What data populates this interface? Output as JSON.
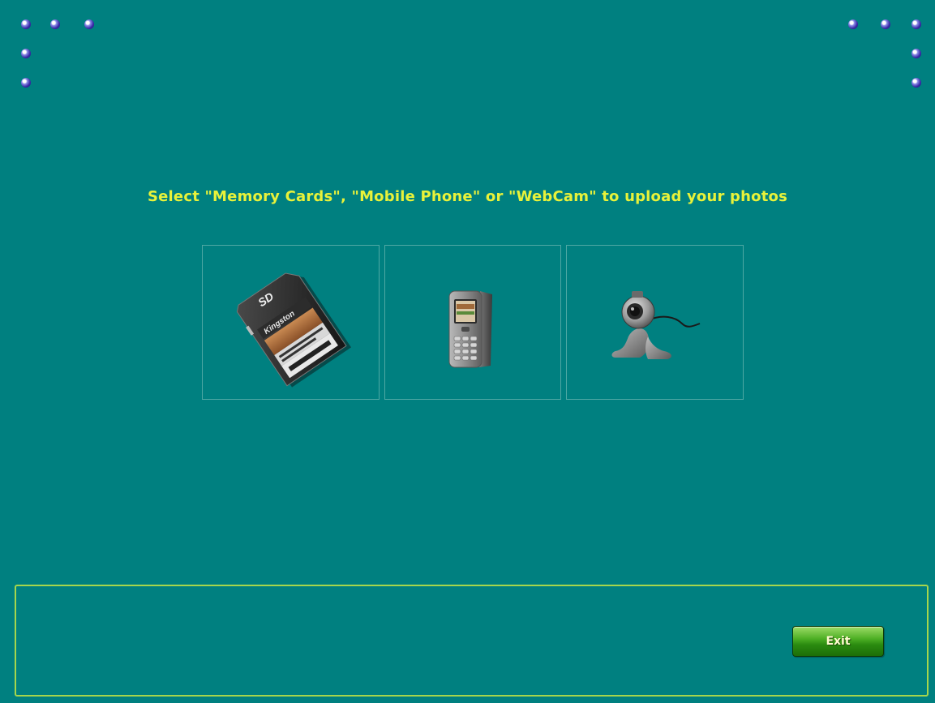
{
  "prompt": {
    "text": "Select \"Memory Cards\", \"Mobile Phone\" or \"WebCam\" to upload your photos"
  },
  "sources": [
    {
      "id": "memory-cards",
      "icon": "memory-card-icon"
    },
    {
      "id": "mobile-phone",
      "icon": "mobile-phone-icon"
    },
    {
      "id": "webcam",
      "icon": "webcam-icon"
    }
  ],
  "footer": {
    "exit_label": "Exit"
  },
  "colors": {
    "background": "#008080",
    "prompt_text": "#e8f23a",
    "footer_border": "#a6d64c",
    "exit_button": "#3ea01c"
  }
}
